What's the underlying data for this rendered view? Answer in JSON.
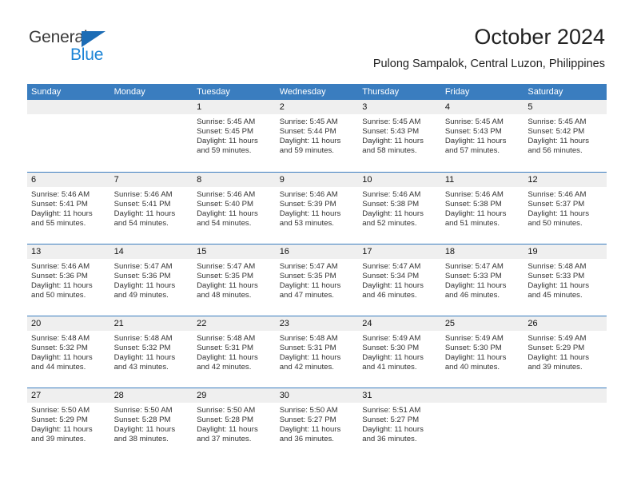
{
  "logo": {
    "primary": "General",
    "secondary": "Blue",
    "triangle_color": "#1c6cb5",
    "primary_color": "#3a3a3a",
    "secondary_color": "#1c84d6"
  },
  "header": {
    "title": "October 2024",
    "subtitle": "Pulong Sampalok, Central Luzon, Philippines"
  },
  "theme": {
    "header_blue": "#3a7dbf",
    "day_band_gray": "#efefef",
    "text": "#333333"
  },
  "weekdays": [
    "Sunday",
    "Monday",
    "Tuesday",
    "Wednesday",
    "Thursday",
    "Friday",
    "Saturday"
  ],
  "weeks": [
    [
      {
        "day": "",
        "sunrise": "",
        "sunset": "",
        "daylight_line1": "",
        "daylight_line2": ""
      },
      {
        "day": "",
        "sunrise": "",
        "sunset": "",
        "daylight_line1": "",
        "daylight_line2": ""
      },
      {
        "day": "1",
        "sunrise": "Sunrise: 5:45 AM",
        "sunset": "Sunset: 5:45 PM",
        "daylight_line1": "Daylight: 11 hours",
        "daylight_line2": "and 59 minutes."
      },
      {
        "day": "2",
        "sunrise": "Sunrise: 5:45 AM",
        "sunset": "Sunset: 5:44 PM",
        "daylight_line1": "Daylight: 11 hours",
        "daylight_line2": "and 59 minutes."
      },
      {
        "day": "3",
        "sunrise": "Sunrise: 5:45 AM",
        "sunset": "Sunset: 5:43 PM",
        "daylight_line1": "Daylight: 11 hours",
        "daylight_line2": "and 58 minutes."
      },
      {
        "day": "4",
        "sunrise": "Sunrise: 5:45 AM",
        "sunset": "Sunset: 5:43 PM",
        "daylight_line1": "Daylight: 11 hours",
        "daylight_line2": "and 57 minutes."
      },
      {
        "day": "5",
        "sunrise": "Sunrise: 5:45 AM",
        "sunset": "Sunset: 5:42 PM",
        "daylight_line1": "Daylight: 11 hours",
        "daylight_line2": "and 56 minutes."
      }
    ],
    [
      {
        "day": "6",
        "sunrise": "Sunrise: 5:46 AM",
        "sunset": "Sunset: 5:41 PM",
        "daylight_line1": "Daylight: 11 hours",
        "daylight_line2": "and 55 minutes."
      },
      {
        "day": "7",
        "sunrise": "Sunrise: 5:46 AM",
        "sunset": "Sunset: 5:41 PM",
        "daylight_line1": "Daylight: 11 hours",
        "daylight_line2": "and 54 minutes."
      },
      {
        "day": "8",
        "sunrise": "Sunrise: 5:46 AM",
        "sunset": "Sunset: 5:40 PM",
        "daylight_line1": "Daylight: 11 hours",
        "daylight_line2": "and 54 minutes."
      },
      {
        "day": "9",
        "sunrise": "Sunrise: 5:46 AM",
        "sunset": "Sunset: 5:39 PM",
        "daylight_line1": "Daylight: 11 hours",
        "daylight_line2": "and 53 minutes."
      },
      {
        "day": "10",
        "sunrise": "Sunrise: 5:46 AM",
        "sunset": "Sunset: 5:38 PM",
        "daylight_line1": "Daylight: 11 hours",
        "daylight_line2": "and 52 minutes."
      },
      {
        "day": "11",
        "sunrise": "Sunrise: 5:46 AM",
        "sunset": "Sunset: 5:38 PM",
        "daylight_line1": "Daylight: 11 hours",
        "daylight_line2": "and 51 minutes."
      },
      {
        "day": "12",
        "sunrise": "Sunrise: 5:46 AM",
        "sunset": "Sunset: 5:37 PM",
        "daylight_line1": "Daylight: 11 hours",
        "daylight_line2": "and 50 minutes."
      }
    ],
    [
      {
        "day": "13",
        "sunrise": "Sunrise: 5:46 AM",
        "sunset": "Sunset: 5:36 PM",
        "daylight_line1": "Daylight: 11 hours",
        "daylight_line2": "and 50 minutes."
      },
      {
        "day": "14",
        "sunrise": "Sunrise: 5:47 AM",
        "sunset": "Sunset: 5:36 PM",
        "daylight_line1": "Daylight: 11 hours",
        "daylight_line2": "and 49 minutes."
      },
      {
        "day": "15",
        "sunrise": "Sunrise: 5:47 AM",
        "sunset": "Sunset: 5:35 PM",
        "daylight_line1": "Daylight: 11 hours",
        "daylight_line2": "and 48 minutes."
      },
      {
        "day": "16",
        "sunrise": "Sunrise: 5:47 AM",
        "sunset": "Sunset: 5:35 PM",
        "daylight_line1": "Daylight: 11 hours",
        "daylight_line2": "and 47 minutes."
      },
      {
        "day": "17",
        "sunrise": "Sunrise: 5:47 AM",
        "sunset": "Sunset: 5:34 PM",
        "daylight_line1": "Daylight: 11 hours",
        "daylight_line2": "and 46 minutes."
      },
      {
        "day": "18",
        "sunrise": "Sunrise: 5:47 AM",
        "sunset": "Sunset: 5:33 PM",
        "daylight_line1": "Daylight: 11 hours",
        "daylight_line2": "and 46 minutes."
      },
      {
        "day": "19",
        "sunrise": "Sunrise: 5:48 AM",
        "sunset": "Sunset: 5:33 PM",
        "daylight_line1": "Daylight: 11 hours",
        "daylight_line2": "and 45 minutes."
      }
    ],
    [
      {
        "day": "20",
        "sunrise": "Sunrise: 5:48 AM",
        "sunset": "Sunset: 5:32 PM",
        "daylight_line1": "Daylight: 11 hours",
        "daylight_line2": "and 44 minutes."
      },
      {
        "day": "21",
        "sunrise": "Sunrise: 5:48 AM",
        "sunset": "Sunset: 5:32 PM",
        "daylight_line1": "Daylight: 11 hours",
        "daylight_line2": "and 43 minutes."
      },
      {
        "day": "22",
        "sunrise": "Sunrise: 5:48 AM",
        "sunset": "Sunset: 5:31 PM",
        "daylight_line1": "Daylight: 11 hours",
        "daylight_line2": "and 42 minutes."
      },
      {
        "day": "23",
        "sunrise": "Sunrise: 5:48 AM",
        "sunset": "Sunset: 5:31 PM",
        "daylight_line1": "Daylight: 11 hours",
        "daylight_line2": "and 42 minutes."
      },
      {
        "day": "24",
        "sunrise": "Sunrise: 5:49 AM",
        "sunset": "Sunset: 5:30 PM",
        "daylight_line1": "Daylight: 11 hours",
        "daylight_line2": "and 41 minutes."
      },
      {
        "day": "25",
        "sunrise": "Sunrise: 5:49 AM",
        "sunset": "Sunset: 5:30 PM",
        "daylight_line1": "Daylight: 11 hours",
        "daylight_line2": "and 40 minutes."
      },
      {
        "day": "26",
        "sunrise": "Sunrise: 5:49 AM",
        "sunset": "Sunset: 5:29 PM",
        "daylight_line1": "Daylight: 11 hours",
        "daylight_line2": "and 39 minutes."
      }
    ],
    [
      {
        "day": "27",
        "sunrise": "Sunrise: 5:50 AM",
        "sunset": "Sunset: 5:29 PM",
        "daylight_line1": "Daylight: 11 hours",
        "daylight_line2": "and 39 minutes."
      },
      {
        "day": "28",
        "sunrise": "Sunrise: 5:50 AM",
        "sunset": "Sunset: 5:28 PM",
        "daylight_line1": "Daylight: 11 hours",
        "daylight_line2": "and 38 minutes."
      },
      {
        "day": "29",
        "sunrise": "Sunrise: 5:50 AM",
        "sunset": "Sunset: 5:28 PM",
        "daylight_line1": "Daylight: 11 hours",
        "daylight_line2": "and 37 minutes."
      },
      {
        "day": "30",
        "sunrise": "Sunrise: 5:50 AM",
        "sunset": "Sunset: 5:27 PM",
        "daylight_line1": "Daylight: 11 hours",
        "daylight_line2": "and 36 minutes."
      },
      {
        "day": "31",
        "sunrise": "Sunrise: 5:51 AM",
        "sunset": "Sunset: 5:27 PM",
        "daylight_line1": "Daylight: 11 hours",
        "daylight_line2": "and 36 minutes."
      },
      {
        "day": "",
        "sunrise": "",
        "sunset": "",
        "daylight_line1": "",
        "daylight_line2": ""
      },
      {
        "day": "",
        "sunrise": "",
        "sunset": "",
        "daylight_line1": "",
        "daylight_line2": ""
      }
    ]
  ]
}
